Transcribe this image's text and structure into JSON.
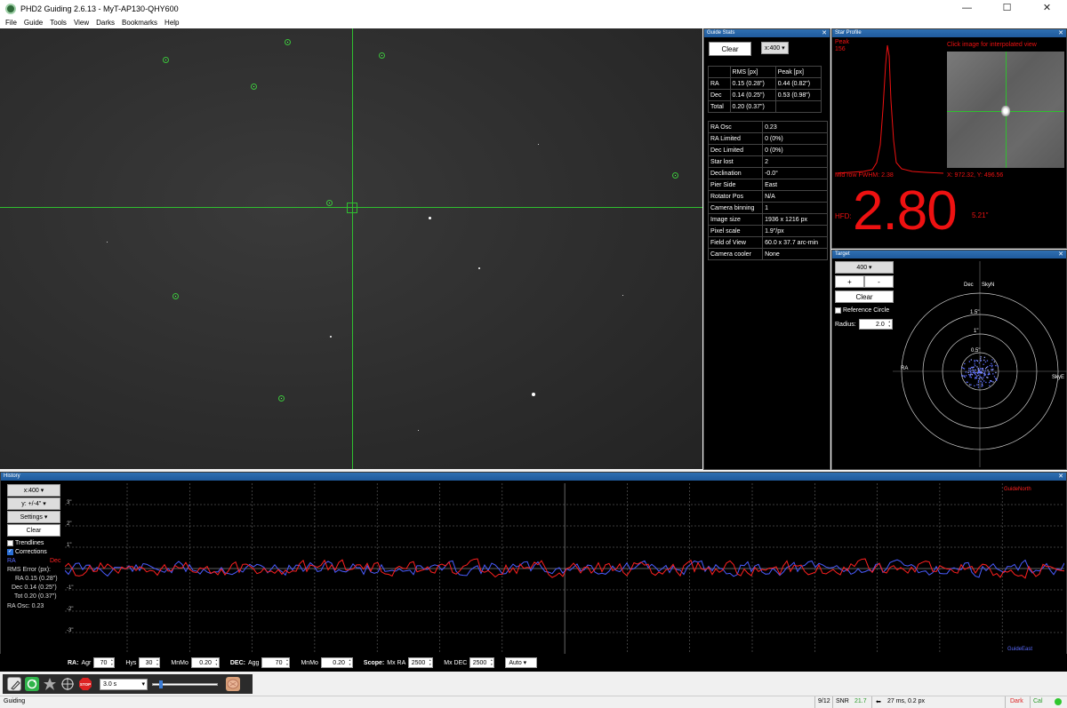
{
  "window": {
    "title": "PHD2 Guiding 2.6.13 - MyT-AP130-QHY600",
    "controls": [
      "—",
      "☐",
      "✕"
    ]
  },
  "menu": [
    "File",
    "Guide",
    "Tools",
    "View",
    "Darks",
    "Bookmarks",
    "Help"
  ],
  "guide_stats": {
    "title": "Guide Stats",
    "clear_label": "Clear",
    "scale": "x:400",
    "rms_headers": [
      "",
      "RMS [px]",
      "Peak [px]"
    ],
    "rms_rows": [
      [
        "RA",
        "0.15 (0.28\")",
        "0.44 (0.82\")"
      ],
      [
        "Dec",
        "0.14 (0.25\")",
        "0.53 (0.98\")"
      ],
      [
        "Total",
        "0.20 (0.37\")",
        ""
      ]
    ],
    "info_rows": [
      [
        "RA Osc",
        "0.23"
      ],
      [
        "RA Limited",
        "0 (0%)"
      ],
      [
        "Dec Limited",
        "0 (0%)"
      ],
      [
        "Star lost",
        "2"
      ],
      [
        "Declination",
        "-0.0°"
      ],
      [
        "Pier Side",
        "East"
      ],
      [
        "Rotator Pos",
        "N/A"
      ],
      [
        "Camera binning",
        "1"
      ],
      [
        "Image size",
        "1936 x 1216 px"
      ],
      [
        "Pixel scale",
        "1.9\"/px"
      ],
      [
        "Field of View",
        "60.0 x  37.7  arc-min"
      ],
      [
        "Camera cooler",
        "None"
      ]
    ]
  },
  "star_profile": {
    "title": "Star Profile",
    "peak_label": "Peak",
    "peak_value": "156",
    "hint": "Click image for interpolated view",
    "fwhm": "Mid row FWHM: 2.38",
    "coords": "X: 972.32, Y: 496.56",
    "hfd_label": "HFD:",
    "hfd_value": "2.80",
    "hfd_arcsec": "5.21\""
  },
  "target": {
    "title": "Target",
    "scale": "400",
    "plus": "+",
    "minus": "-",
    "clear_label": "Clear",
    "reference_circle": "Reference Circle",
    "radius_label": "Radius:",
    "radius_value": "2.0",
    "labels": {
      "dec": "Dec",
      "skyn": "SkyN",
      "ra": "RA",
      "skye": "SkyE",
      "r15": "1.5\"",
      "r1": "1\"",
      "r05": "0.5\""
    }
  },
  "history": {
    "title": "History",
    "x_scale": "x:400",
    "y_scale": "y: +/-4\"",
    "settings": "Settings",
    "clear_label": "Clear",
    "trendlines": "Trendlines",
    "corrections": "Corrections",
    "ra_legend": "RA",
    "dec_legend": "Dec",
    "rms_title": "RMS Error (px):",
    "rms_ra": "RA 0.15 (0.28\")",
    "rms_dec": "Dec 0.14 (0.25\")",
    "rms_tot": "Tot 0.20 (0.37\")",
    "ra_osc": "RA Osc: 0.23",
    "y_ticks": [
      "3\"",
      "2\"",
      "1\"",
      "-1\"",
      "-2\"",
      "-3\""
    ],
    "guide_north": "GuideNorth",
    "guide_east": "GuideEast",
    "colors": {
      "ra": "#4a5cff",
      "dec": "#ff2020"
    }
  },
  "params": {
    "ra_label": "RA:",
    "agr_label": "Agr",
    "agr": "70",
    "hys_label": "Hys",
    "hys": "30",
    "minmo_label": "MnMo",
    "ra_minmo": "0.20",
    "dec_label": "DEC:",
    "agg_label": "Agg",
    "dec_agg": "70",
    "dec_minmo": "0.20",
    "scope_label": "Scope:",
    "mxra_label": "Mx RA",
    "mxra": "2500",
    "mxdec_label": "Mx DEC",
    "mxdec": "2500",
    "mode": "Auto"
  },
  "toolbar": {
    "exposure": "3.0 s",
    "gamma": 0.1,
    "stop_label": "STOP"
  },
  "status": {
    "state": "Guiding",
    "frames": "9/12",
    "snr_label": "SNR",
    "snr": "21.7",
    "pulse": "27 ms, 0.2 px",
    "darks": "Dark",
    "cal": "Cal"
  }
}
